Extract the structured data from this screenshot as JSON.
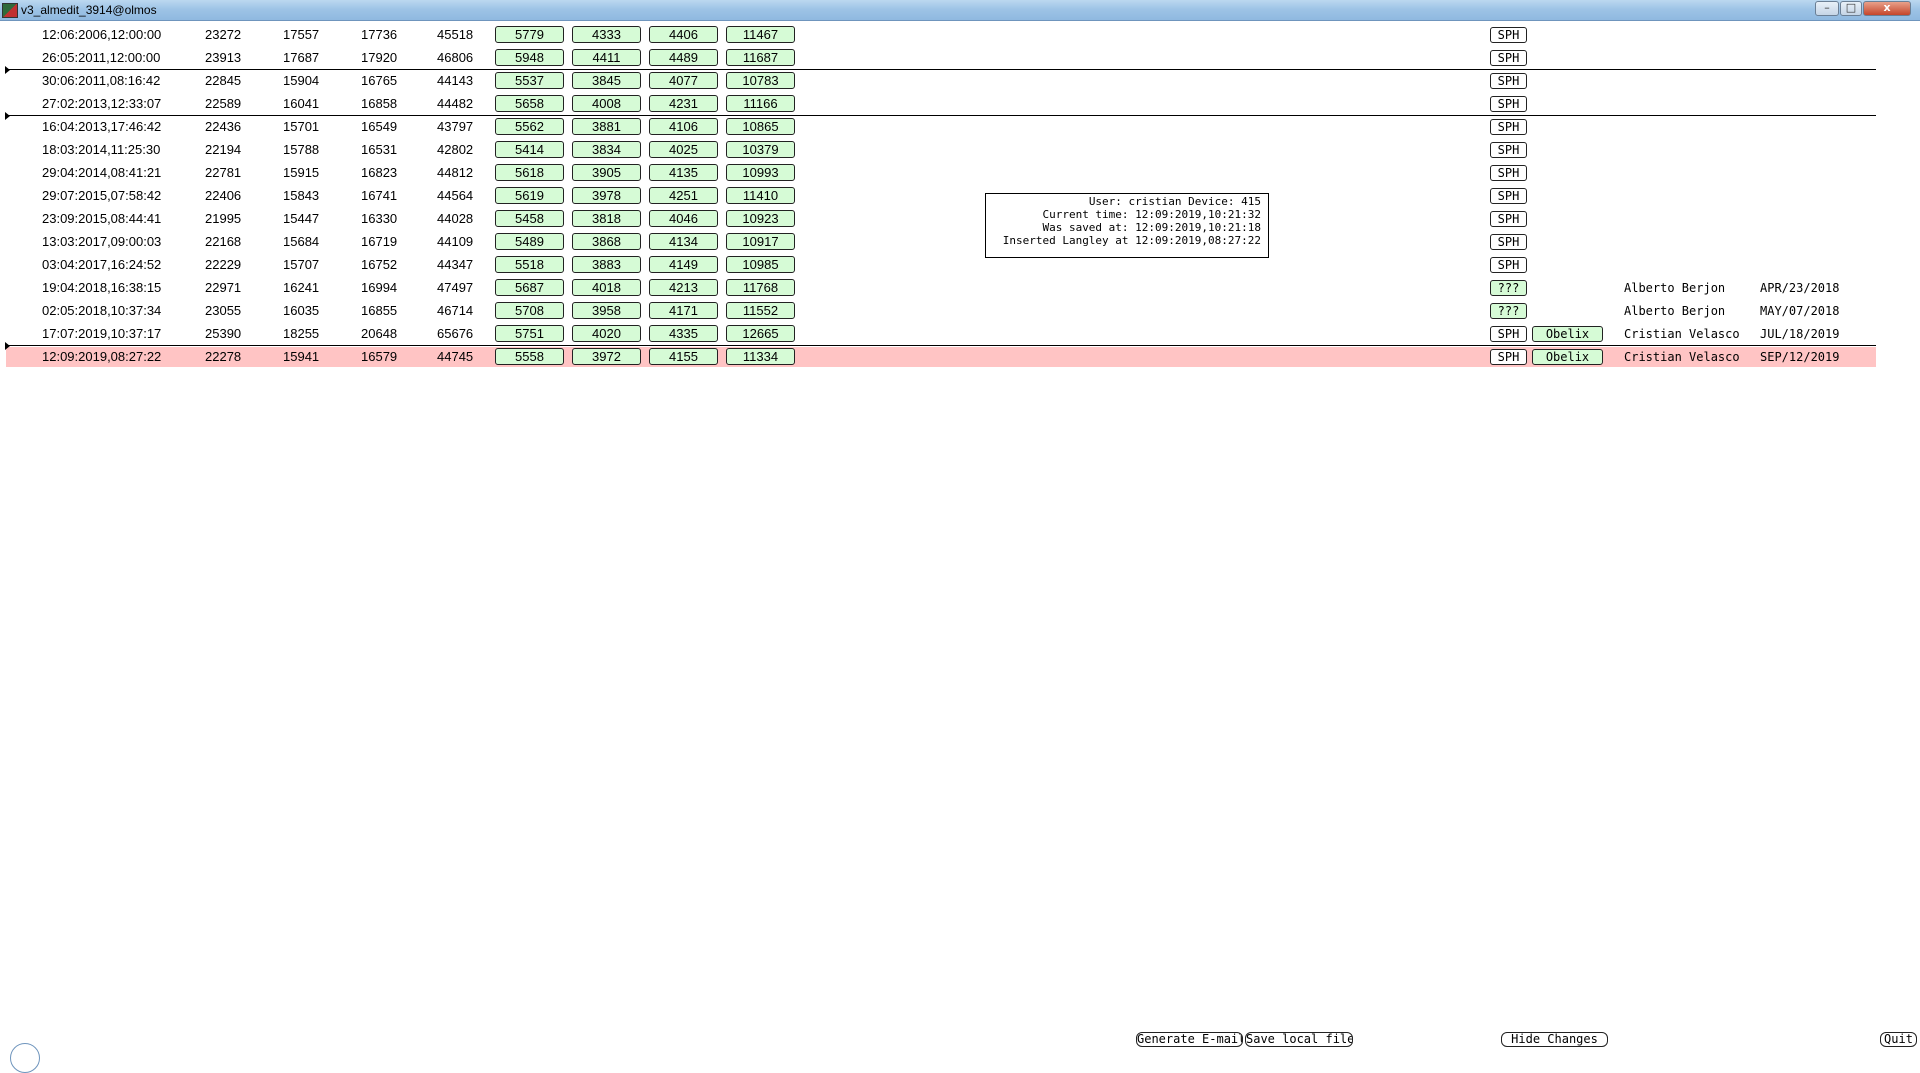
{
  "window": {
    "title": "v3_almedit_3914@olmos",
    "min_label": "–",
    "max_label": "□",
    "close_label": "x"
  },
  "rows": [
    {
      "date": "12:06:2006,12:00:00",
      "a": "23272",
      "b": "17557",
      "c": "17736",
      "d": "45518",
      "g": [
        "5779",
        "4333",
        "4406",
        "11467"
      ],
      "status": "SPH"
    },
    {
      "date": "26:05:2011,12:00:00",
      "a": "23913",
      "b": "17687",
      "c": "17920",
      "d": "46806",
      "g": [
        "5948",
        "4411",
        "4489",
        "11687"
      ],
      "status": "SPH"
    },
    {
      "date": "30:06:2011,08:16:42",
      "a": "22845",
      "b": "15904",
      "c": "16765",
      "d": "44143",
      "g": [
        "5537",
        "3845",
        "4077",
        "10783"
      ],
      "status": "SPH"
    },
    {
      "date": "27:02:2013,12:33:07",
      "a": "22589",
      "b": "16041",
      "c": "16858",
      "d": "44482",
      "g": [
        "5658",
        "4008",
        "4231",
        "11166"
      ],
      "status": "SPH"
    },
    {
      "date": "16:04:2013,17:46:42",
      "a": "22436",
      "b": "15701",
      "c": "16549",
      "d": "43797",
      "g": [
        "5562",
        "3881",
        "4106",
        "10865"
      ],
      "status": "SPH"
    },
    {
      "date": "18:03:2014,11:25:30",
      "a": "22194",
      "b": "15788",
      "c": "16531",
      "d": "42802",
      "g": [
        "5414",
        "3834",
        "4025",
        "10379"
      ],
      "status": "SPH"
    },
    {
      "date": "29:04:2014,08:41:21",
      "a": "22781",
      "b": "15915",
      "c": "16823",
      "d": "44812",
      "g": [
        "5618",
        "3905",
        "4135",
        "10993"
      ],
      "status": "SPH"
    },
    {
      "date": "29:07:2015,07:58:42",
      "a": "22406",
      "b": "15843",
      "c": "16741",
      "d": "44564",
      "g": [
        "5619",
        "3978",
        "4251",
        "11410"
      ],
      "status": "SPH"
    },
    {
      "date": "23:09:2015,08:44:41",
      "a": "21995",
      "b": "15447",
      "c": "16330",
      "d": "44028",
      "g": [
        "5458",
        "3818",
        "4046",
        "10923"
      ],
      "status": "SPH"
    },
    {
      "date": "13:03:2017,09:00:03",
      "a": "22168",
      "b": "15684",
      "c": "16719",
      "d": "44109",
      "g": [
        "5489",
        "3868",
        "4134",
        "10917"
      ],
      "status": "SPH"
    },
    {
      "date": "03:04:2017,16:24:52",
      "a": "22229",
      "b": "15707",
      "c": "16752",
      "d": "44347",
      "g": [
        "5518",
        "3883",
        "4149",
        "10985"
      ],
      "status": "SPH"
    },
    {
      "date": "19:04:2018,16:38:15",
      "a": "22971",
      "b": "16241",
      "c": "16994",
      "d": "47497",
      "g": [
        "5687",
        "4018",
        "4213",
        "11768"
      ],
      "status": "???",
      "user": "Alberto Berjon",
      "udate": "APR/23/2018"
    },
    {
      "date": "02:05:2018,10:37:34",
      "a": "23055",
      "b": "16035",
      "c": "16855",
      "d": "46714",
      "g": [
        "5708",
        "3958",
        "4171",
        "11552"
      ],
      "status": "???",
      "user": "Alberto Berjon",
      "udate": "MAY/07/2018"
    },
    {
      "date": "17:07:2019,10:37:17",
      "a": "25390",
      "b": "18255",
      "c": "20648",
      "d": "65676",
      "g": [
        "5751",
        "4020",
        "4335",
        "12665"
      ],
      "status": "SPH",
      "obelix": "Obelix",
      "user": "Cristian Velasco",
      "udate": "JUL/18/2019"
    },
    {
      "date": "12:09:2019,08:27:22",
      "a": "22278",
      "b": "15941",
      "c": "16579",
      "d": "44745",
      "g": [
        "5558",
        "3972",
        "4155",
        "11334"
      ],
      "status": "SPH",
      "obelix": "Obelix",
      "user": "Cristian Velasco",
      "udate": "SEP/12/2019"
    }
  ],
  "info": {
    "line1": "User: cristian Device: 415",
    "line2": "Current time: 12:09:2019,10:21:32",
    "line3": "Was saved at: 12:09:2019,10:21:18",
    "line4": "Inserted Langley at 12:09:2019,08:27:22"
  },
  "buttons": {
    "generate_email": "Generate E-mail",
    "save_local": "Save local file",
    "hide_changes": "Hide Changes",
    "quit": "Quit"
  },
  "colors": {
    "highlight_row": "#ffc4c4",
    "green_button": "#d6fbd6",
    "titlebar": "#9ec4e6"
  }
}
